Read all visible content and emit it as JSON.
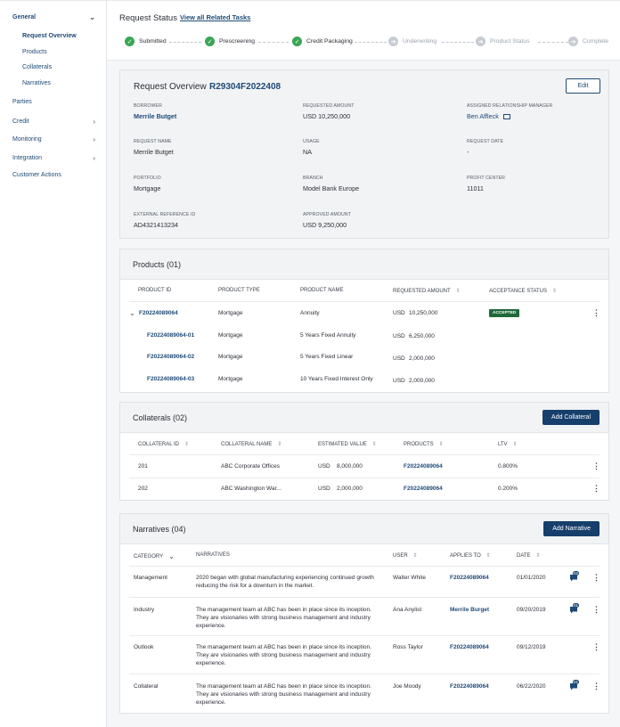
{
  "sidebar": {
    "items": [
      {
        "label": "General",
        "chevron": "chevron-down-icon"
      },
      {
        "label": "Parties"
      },
      {
        "label": "Credit",
        "chevron": "chevron-right-icon"
      },
      {
        "label": "Monitoring",
        "chevron": "chevron-right-icon"
      },
      {
        "label": "Integration",
        "chevron": "chevron-right-icon"
      },
      {
        "label": "Customer Actions"
      }
    ],
    "general_sub": [
      "Request Overview",
      "Products",
      "Collaterals",
      "Narratives"
    ]
  },
  "header": {
    "title": "Request Status",
    "link": "View all Related Tasks",
    "steps": [
      {
        "label": "Submitted",
        "state": "done"
      },
      {
        "label": "Prescreening",
        "state": "done"
      },
      {
        "label": "Credit Packaging",
        "state": "done"
      },
      {
        "label": "Underwriting",
        "state": "pending"
      },
      {
        "label": "Product Status",
        "state": "pending"
      },
      {
        "label": "Complete",
        "state": "pending"
      }
    ]
  },
  "overview": {
    "title": "Request Overview",
    "request_id": "R29304F2022408",
    "edit_label": "Edit",
    "fields": {
      "borrower_label": "BORROWER",
      "borrower": "Merrile Butget",
      "requested_amount_label": "REQUESTED AMOUNT",
      "requested_amount": "USD 10,250,000",
      "rm_label": "ASSIGNED RELATIONSHIP MANAGER",
      "rm": "Ben Affleck",
      "request_name_label": "REQUEST NAME",
      "request_name": "Merrile Butget",
      "usage_label": "USAGE",
      "usage": "NA",
      "request_date_label": "REQUEST DATE",
      "request_date": "-",
      "portfolio_label": "PORTFOLIO",
      "portfolio": "Mortgage",
      "branch_label": "BRANCH",
      "branch": "Model Bank Europe",
      "profit_center_label": "PROFIT CENTER",
      "profit_center": "11011",
      "ext_ref_label": "EXTERNAL REFERENCE ID",
      "ext_ref": "AD4321413234",
      "approved_amount_label": "APPROVED AMOUNT",
      "approved_amount": "USD 9,250,000"
    }
  },
  "products": {
    "title": "Products (01)",
    "columns": [
      "PRODUCT ID",
      "PRODUCT TYPE",
      "PRODUCT NAME",
      "REQUESTED AMOUNT",
      "ACCEPTANCE STATUS"
    ],
    "rows": [
      {
        "id": "F20224089064",
        "type": "Mortgage",
        "name": "Annuity",
        "currency": "USD",
        "amount": "10,250,000",
        "status": "ACCEPTED"
      },
      {
        "id": "F20224089064-01",
        "type": "Mortgage",
        "name": "5 Years Fixed Annuity",
        "currency": "USD",
        "amount": "6,250,000"
      },
      {
        "id": "F20224089064-02",
        "type": "Mortgage",
        "name": "5 Years Fixed Linear",
        "currency": "USD",
        "amount": "2,000,000"
      },
      {
        "id": "F20224089064-03",
        "type": "Mortgage",
        "name": "10 Years Fixed Interest Only",
        "currency": "USD",
        "amount": "2,000,000"
      }
    ]
  },
  "collaterals": {
    "title": "Collaterals (02)",
    "add_label": "Add Collateral",
    "columns": [
      "COLLATERAL ID",
      "COLLATERAL NAME",
      "ESTIMATED VALUE",
      "PRODUCTS",
      "LTV"
    ],
    "rows": [
      {
        "id": "201",
        "name": "ABC Corporate Offices",
        "currency": "USD",
        "value": "8,000,000",
        "product": "F20224089064",
        "ltv": "0.800%"
      },
      {
        "id": "202",
        "name": "ABC Washington War...",
        "currency": "USD",
        "value": "2,000,000",
        "product": "F20224089064",
        "ltv": "0.200%"
      }
    ]
  },
  "narratives": {
    "title": "Narratives (04)",
    "add_label": "Add Narrative",
    "columns": [
      "CATEGORY",
      "NARRATIVES",
      "USER",
      "APPLIES TO",
      "DATE"
    ],
    "rows": [
      {
        "category": "Management",
        "text": "2020 began with global manufacturing experiencing continued growth reducing the risk for a downturn in the market.",
        "user": "Walter White",
        "applies": "F20224089064",
        "date": "01/01/2020",
        "comments": "02"
      },
      {
        "category": "Industry",
        "text": "The management team at ABC has been in place since its inception. They are visionaries with strong business management and industry experience.",
        "user": "Ana Anylist",
        "applies": "Merrile Burget",
        "date": "09/20/2019",
        "comments": "01"
      },
      {
        "category": "Outlook",
        "text": "The management team at ABC has been in place since its inception. They are visionaries with strong business management and industry experience.",
        "user": "Ross Taylor",
        "applies": "F20224089064",
        "date": "09/12/2019",
        "comments": ""
      },
      {
        "category": "Collateral",
        "text": "The management team at ABC has been in place since its inception. They are visionaries with strong business management and industry experience.",
        "user": "Joe Moody",
        "applies": "F20224089064",
        "date": "06/22/2020",
        "comments": "01"
      }
    ]
  },
  "colors": {
    "accent": "#1e4a77",
    "success": "#3aa655",
    "badge": "#1f6a3a",
    "primary_button": "#163f6b"
  }
}
